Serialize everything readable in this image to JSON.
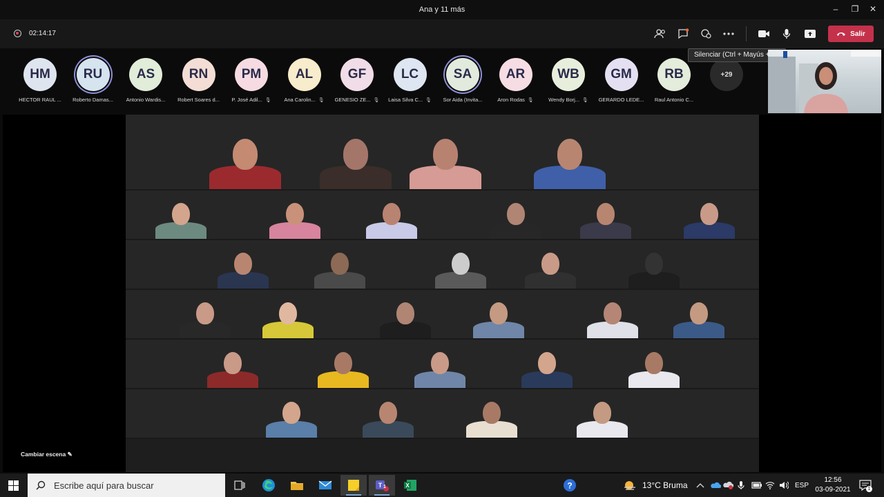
{
  "window": {
    "title": "Ana y 11 más"
  },
  "meeting": {
    "timer": "02:14:17",
    "leave_label": "Salir",
    "tooltip": "Silenciar (Ctrl + Mayús + M)",
    "overflow_count": "+29",
    "change_scene_label": "Cambiar escena",
    "toolbar_icons": [
      "participants-icon",
      "chat-icon",
      "reactions-icon",
      "more-icon",
      "camera-icon",
      "mic-icon",
      "share-icon"
    ]
  },
  "participants": [
    {
      "initials": "HM",
      "name": "HECTOR RAUL ...",
      "color": "#dfe5ef",
      "muted": false,
      "speaking": false
    },
    {
      "initials": "RU",
      "name": "Roberto Damas...",
      "color": "#d5e4ee",
      "muted": false,
      "speaking": true
    },
    {
      "initials": "AS",
      "name": "Antonio Wardis...",
      "color": "#e1ecd9",
      "muted": false,
      "speaking": false
    },
    {
      "initials": "RN",
      "name": "Robert Soares d...",
      "color": "#f3ddd5",
      "muted": false,
      "speaking": false
    },
    {
      "initials": "PM",
      "name": "P. José Adil...",
      "color": "#f6dbe3",
      "muted": true,
      "speaking": false
    },
    {
      "initials": "AL",
      "name": "Ana Carolin...",
      "color": "#f7eccb",
      "muted": true,
      "speaking": false
    },
    {
      "initials": "GF",
      "name": "GENESIO ZE...",
      "color": "#f1dde7",
      "muted": true,
      "speaking": false
    },
    {
      "initials": "LC",
      "name": "Laisa Silva C...",
      "color": "#dde6f1",
      "muted": true,
      "speaking": false
    },
    {
      "initials": "SA",
      "name": "Sor Aida (Invita...",
      "color": "#e1eadd",
      "muted": false,
      "speaking": true
    },
    {
      "initials": "AR",
      "name": "Aron Rodas",
      "color": "#f6dde4",
      "muted": true,
      "speaking": false
    },
    {
      "initials": "WB",
      "name": "Wendy Borj...",
      "color": "#e8eedc",
      "muted": true,
      "speaking": false
    },
    {
      "initials": "GM",
      "name": "GERARDO LEDE...",
      "color": "#e4e0f2",
      "muted": false,
      "speaking": false
    },
    {
      "initials": "RB",
      "name": "Raul Antonio C...",
      "color": "#e4ecdb",
      "muted": false,
      "speaking": false
    }
  ],
  "taskbar": {
    "search_placeholder": "Escribe aquí para buscar",
    "weather": "13°C  Bruma",
    "language": "ESP",
    "time": "12:56",
    "date": "03-09-2021",
    "notification_count": "1",
    "teams_badge": "1"
  }
}
